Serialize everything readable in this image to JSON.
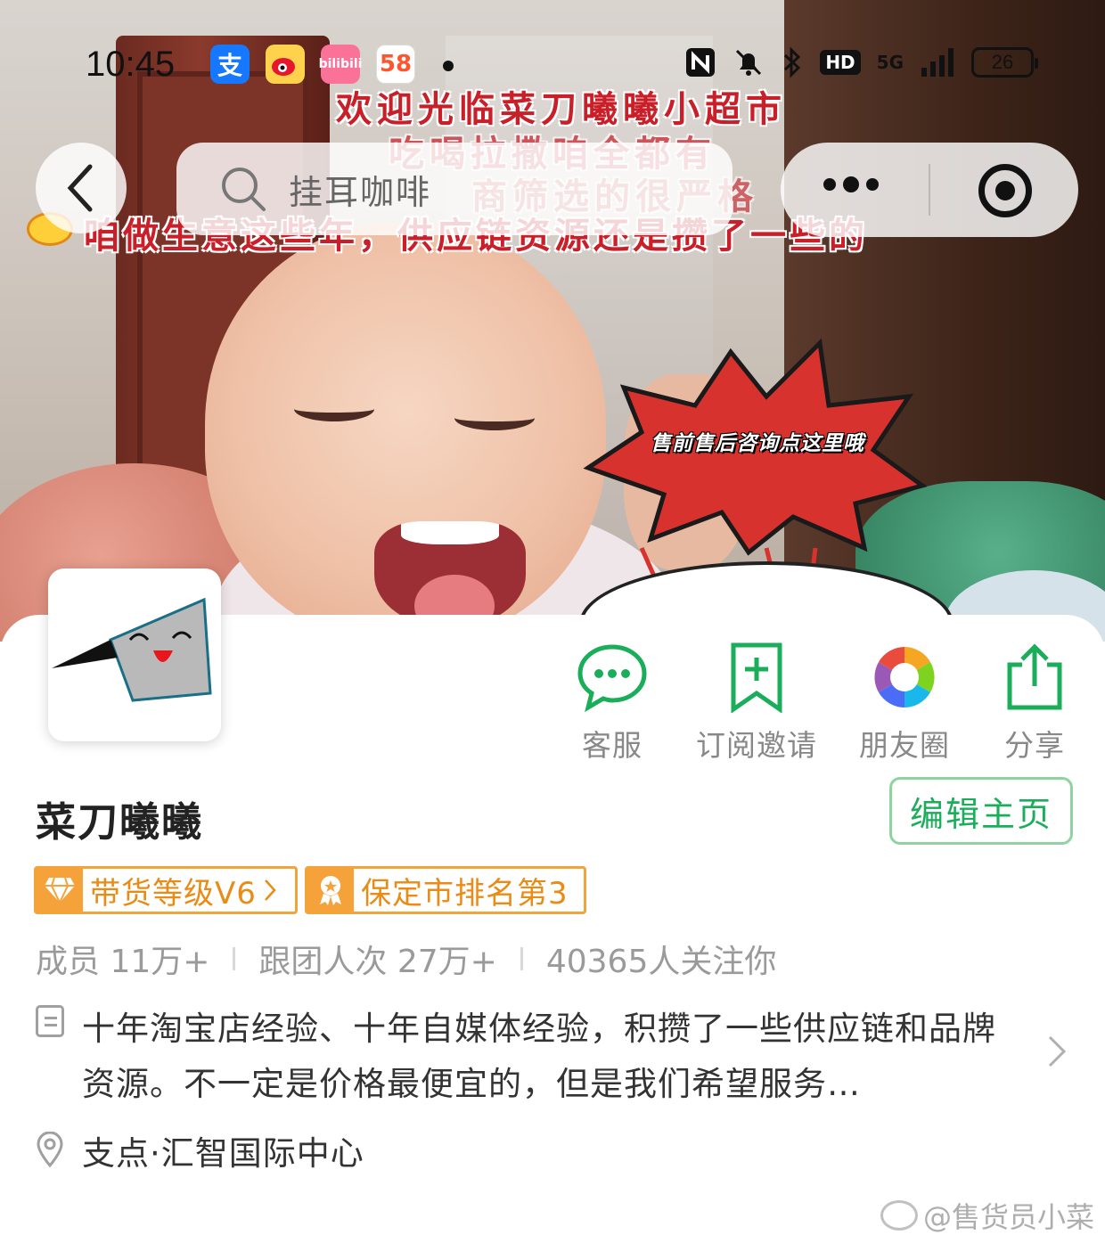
{
  "status_bar": {
    "time": "10:45",
    "apps": [
      "alipay-icon",
      "weibo-icon",
      "bilibili-icon",
      "58-icon"
    ],
    "app_glyphs": {
      "alipay": "支",
      "bilibili": "bilibili",
      "five8": "58"
    },
    "hd": "HD",
    "network": "5G",
    "battery": "26"
  },
  "banner": {
    "overlay_lines": [
      "欢迎光临菜刀曦曦小超市",
      "吃喝拉撒咱全都有",
      "商筛选的很严格",
      "咱做生意这些年，供应链资源还是攒了一些的"
    ],
    "burst_text": "售前售后咨询点这里哦"
  },
  "nav": {
    "search_placeholder": "挂耳咖啡"
  },
  "actions": [
    {
      "label": "客服",
      "icon": "chat-bubble-icon"
    },
    {
      "label": "订阅邀请",
      "icon": "bookmark-add-icon"
    },
    {
      "label": "朋友圈",
      "icon": "moments-aperture-icon"
    },
    {
      "label": "分享",
      "icon": "share-icon"
    }
  ],
  "profile": {
    "name": "菜刀曦曦",
    "edit_button": "编辑主页",
    "badges": [
      {
        "label": "带货等级V6",
        "icon": "diamond-icon"
      },
      {
        "label": "保定市排名第3",
        "icon": "award-ribbon-icon"
      }
    ],
    "stats": {
      "members": "成员 11万+",
      "participations": "跟团人次 27万+",
      "followers": "40365人关注你"
    },
    "intro": "十年淘宝店经验、十年自媒体经验，积攒了一些供应链和品牌资源。不一定是价格最便宜的，但是我们希望服务…",
    "location": "支点·汇智国际中心"
  },
  "watermark": "@售货员小菜",
  "colors": {
    "accent_green": "#1aad5a",
    "badge_orange": "#f2a33a",
    "overlay_red": "#c91f29"
  }
}
